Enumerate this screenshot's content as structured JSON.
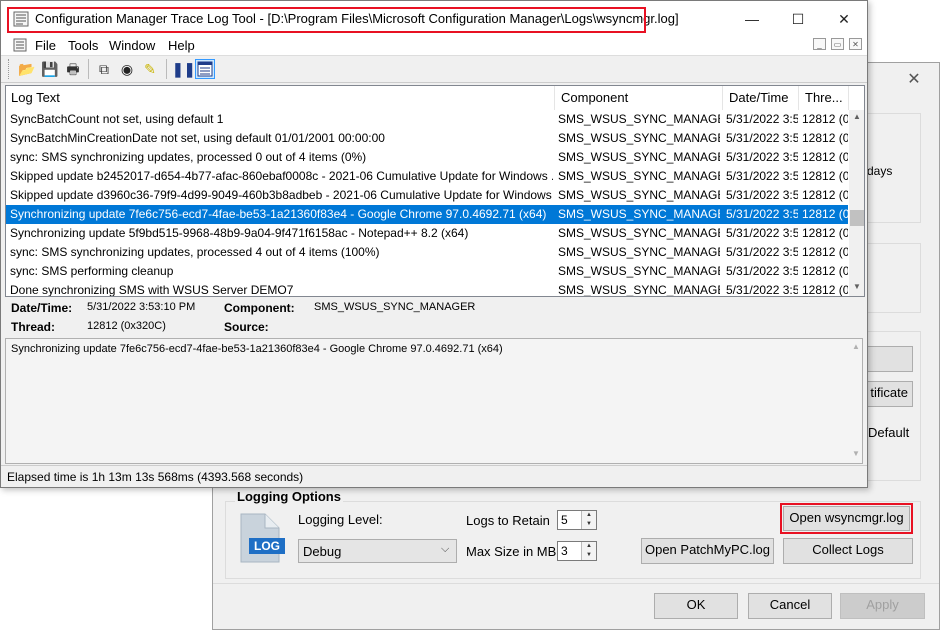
{
  "trace_window": {
    "title": "Configuration Manager Trace Log Tool - [D:\\Program Files\\Microsoft Configuration Manager\\Logs\\wsyncmgr.log]",
    "caption_buttons": {
      "minimize": "—",
      "maximize": "☐",
      "close": "✕"
    },
    "menu": [
      "File",
      "Tools",
      "Window",
      "Help"
    ],
    "mdi_buttons": [
      "_",
      "▭",
      "✕"
    ],
    "columns": [
      "Log Text",
      "Component",
      "Date/Time",
      "Thre..."
    ],
    "rows": [
      {
        "text": "SyncBatchCount not set, using default 1",
        "component": "SMS_WSUS_SYNC_MANAGER",
        "datetime": "5/31/2022 3:5",
        "thread": "12812 (0"
      },
      {
        "text": "SyncBatchMinCreationDate not set, using default 01/01/2001 00:00:00",
        "component": "SMS_WSUS_SYNC_MANAGER",
        "datetime": "5/31/2022 3:5",
        "thread": "12812 (0"
      },
      {
        "text": "sync: SMS synchronizing updates, processed 0 out of 4 items (0%)",
        "component": "SMS_WSUS_SYNC_MANAGER",
        "datetime": "5/31/2022 3:5",
        "thread": "12812 (0"
      },
      {
        "text": "Skipped update b2452017-d654-4b77-afac-860ebaf0008c - 2021-06 Cumulative Update for Windows ....",
        "component": "SMS_WSUS_SYNC_MANAGER",
        "datetime": "5/31/2022 3:5",
        "thread": "12812 (0"
      },
      {
        "text": "Skipped update d3960c36-79f9-4d99-9049-460b3b8adbeb - 2021-06 Cumulative Update for Windows ...",
        "component": "SMS_WSUS_SYNC_MANAGER",
        "datetime": "5/31/2022 3:5",
        "thread": "12812 (0"
      },
      {
        "text": "Synchronizing update 7fe6c756-ecd7-4fae-be53-1a21360f83e4 - Google Chrome 97.0.4692.71 (x64)",
        "component": "SMS_WSUS_SYNC_MANAGER",
        "datetime": "5/31/2022 3:5",
        "thread": "12812 (0"
      },
      {
        "text": "Synchronizing update 5f9bd515-9968-48b9-9a04-9f471f6158ac - Notepad++ 8.2 (x64)",
        "component": "SMS_WSUS_SYNC_MANAGER",
        "datetime": "5/31/2022 3:5",
        "thread": "12812 (0"
      },
      {
        "text": "sync: SMS synchronizing updates, processed 4 out of 4 items (100%)",
        "component": "SMS_WSUS_SYNC_MANAGER",
        "datetime": "5/31/2022 3:5",
        "thread": "12812 (0"
      },
      {
        "text": "sync: SMS performing cleanup",
        "component": "SMS_WSUS_SYNC_MANAGER",
        "datetime": "5/31/2022 3:5",
        "thread": "12812 (0"
      },
      {
        "text": "Done synchronizing SMS with WSUS Server DEMO7",
        "component": "SMS_WSUS_SYNC_MANAGER",
        "datetime": "5/31/2022 3:5",
        "thread": "12812 (0"
      }
    ],
    "selected_row_index": 5,
    "details": {
      "datetime_label": "Date/Time:",
      "datetime_value": "5/31/2022 3:53:10 PM",
      "component_label": "Component:",
      "component_value": "SMS_WSUS_SYNC_MANAGER",
      "thread_label": "Thread:",
      "thread_value": "12812 (0x320C)",
      "source_label": "Source:",
      "source_value": ""
    },
    "message": "Synchronizing update 7fe6c756-ecd7-4fae-be53-1a21360f83e4 - Google Chrome 97.0.4692.71 (x64)",
    "status": "Elapsed time is 1h 13m 13s 568ms (4393.568 seconds)"
  },
  "background_dialog": {
    "partial_texts": [
      "days",
      "tificate",
      "Default"
    ],
    "logging_options": {
      "group_title": "Logging Options",
      "icon_label": "LOG",
      "logging_level_label": "Logging Level:",
      "logging_level_value": "Debug",
      "logs_to_retain_label": "Logs to Retain",
      "logs_to_retain_value": "5",
      "max_size_label": "Max Size in MB",
      "max_size_value": "3",
      "open_wsyncmgr_button": "Open wsyncmgr.log",
      "open_patchmypc_button": "Open PatchMyPC.log",
      "collect_logs_button": "Collect Logs"
    },
    "buttons": {
      "ok": "OK",
      "cancel": "Cancel",
      "apply": "Apply"
    },
    "close_glyph": "✕"
  },
  "colors": {
    "selection": "#0078d7",
    "highlight_box": "#e81123",
    "log_icon": "#1f6fc5"
  }
}
